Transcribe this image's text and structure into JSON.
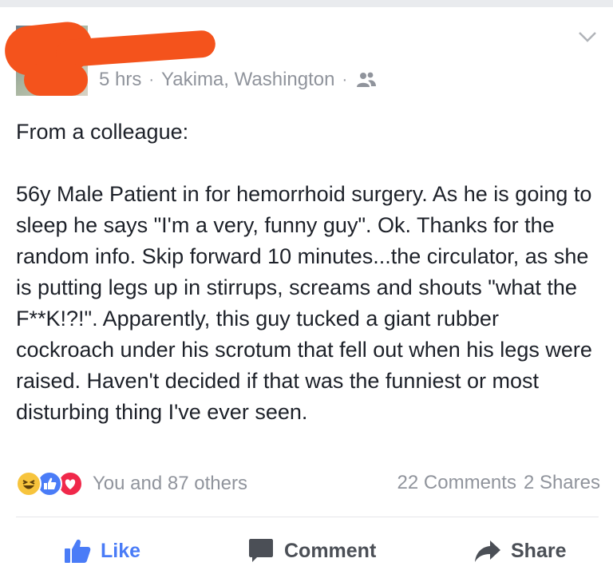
{
  "post": {
    "time": "5 hrs",
    "separator": "·",
    "location": "Yakima, Washington",
    "audience_icon": "friends-icon",
    "body_intro": "From a colleague:",
    "body_text": "56y Male Patient in for hemorrhoid surgery. As he is going to sleep he says \"I'm a very, funny guy\". Ok. Thanks for the random info. Skip forward 10 minutes...the circulator, as she is putting legs up in stirrups, screams and shouts \"what the F**K!?!\". Apparently, this guy tucked a giant rubber cockroach under his scrotum that fell out when his legs were raised. Haven't decided if that was the funniest or most disturbing thing I've ever seen."
  },
  "reactions": {
    "icons": [
      "haha-icon",
      "like-reaction-icon",
      "love-icon"
    ],
    "summary": "You and 87 others",
    "comments": "22 Comments",
    "shares": "2 Shares"
  },
  "actions": {
    "like": "Like",
    "comment": "Comment",
    "share": "Share"
  },
  "colors": {
    "redaction": "#f4531c",
    "like_blue": "#4a7cf7",
    "love_red": "#f0284a",
    "haha_yellow": "#f7c43d",
    "meta_gray": "#90949c",
    "text": "#1d2129"
  }
}
